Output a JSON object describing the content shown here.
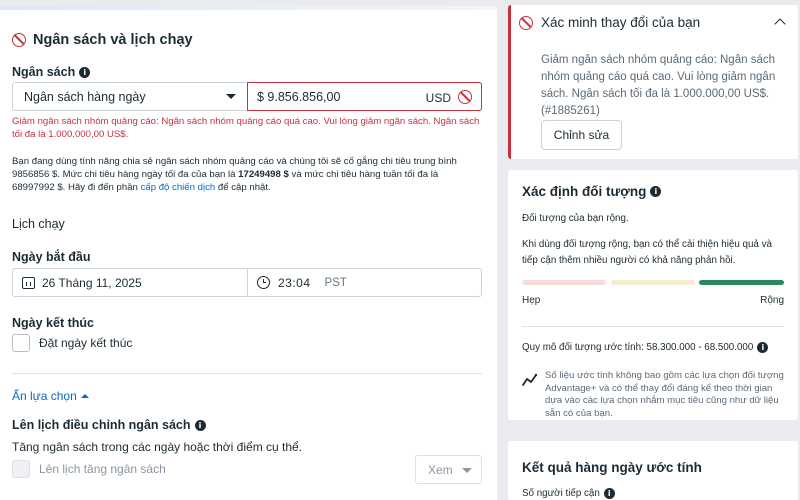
{
  "budget_section": {
    "title": "Ngân sách và lịch chạy",
    "budget_label": "Ngân sách",
    "budget_type": "Ngân sách hàng ngày",
    "amount": "$ 9.856.856,00",
    "currency": "USD",
    "error": "Giảm ngân sách nhóm quảng cáo: Ngân sách nhóm quảng cáo quá cao. Vui lòng giảm ngân sách. Ngân sách tối đa là 1.000.000,00 US$.",
    "note_part1": "Bạn đang dùng tính năng chia sẻ ngân sách nhóm quảng cáo và chúng tôi sẽ cố gắng chi tiêu trung bình 9856856 $. Mức chi tiêu hàng ngày tối đa của bạn là ",
    "note_daily_max": "17249498 $",
    "note_part2": " và mức chi tiêu hàng tuần tối đa là 68997992 $. Hãy đi đến phần ",
    "note_link": "cấp độ chiến dịch",
    "note_part3": " để cập nhật."
  },
  "schedule": {
    "title": "Lịch chạy",
    "start_label": "Ngày bắt đầu",
    "start_date": "26 Tháng 11, 2025",
    "start_time": "23:04",
    "timezone": "PST",
    "end_label": "Ngày kết thúc",
    "end_checkbox": "Đặt ngày kết thúc"
  },
  "options": {
    "hide_link": "Ẩn lựa chọn",
    "budget_schedule_label": "Lên lịch điều chỉnh ngân sách",
    "budget_schedule_desc": "Tăng ngân sách trong các ngày hoặc thời điểm cụ thể.",
    "increase_checkbox": "Lên lịch tăng ngân sách",
    "view_select": "Xem"
  },
  "verify_card": {
    "title": "Xác minh thay đổi của bạn",
    "message": "Giảm ngân sách nhóm quảng cáo: Ngân sách nhóm quảng cáo quá cao. Vui lòng giảm ngân sách. Ngân sách tối đa là 1.000.000,00 US$. (#1885261)",
    "edit_button": "Chỉnh sửa"
  },
  "audience_card": {
    "title": "Xác định đối tượng",
    "status": "Đối tượng của bạn rộng.",
    "tip": "Khi dùng đối tượng rộng, bạn có thể cải thiện hiệu quả và tiếp cận thêm nhiều người có khả năng phản hồi.",
    "narrow_label": "Hẹp",
    "broad_label": "Rộng",
    "size_label": "Quy mô đối tượng ước tính: 58.300.000 - 68.500.000",
    "estimate_note": "Số liệu ước tính không bao gồm các lựa chọn đối tượng Advantage+ và có thể thay đổi đáng kể theo thời gian dựa vào các lựa chọn nhắm mục tiêu cũng như dữ liệu sẵn có của bạn.",
    "meter_colors": [
      "#f6dcdc",
      "#f6ecd2",
      "#2a8a5a"
    ],
    "active_segment": 3
  },
  "daily_card": {
    "title": "Kết quả hàng ngày ước tính",
    "reach_label": "Số người tiếp cận"
  },
  "colors": {
    "error": "#c7303e",
    "link": "#0a66d0",
    "success": "#2a8a5a"
  }
}
